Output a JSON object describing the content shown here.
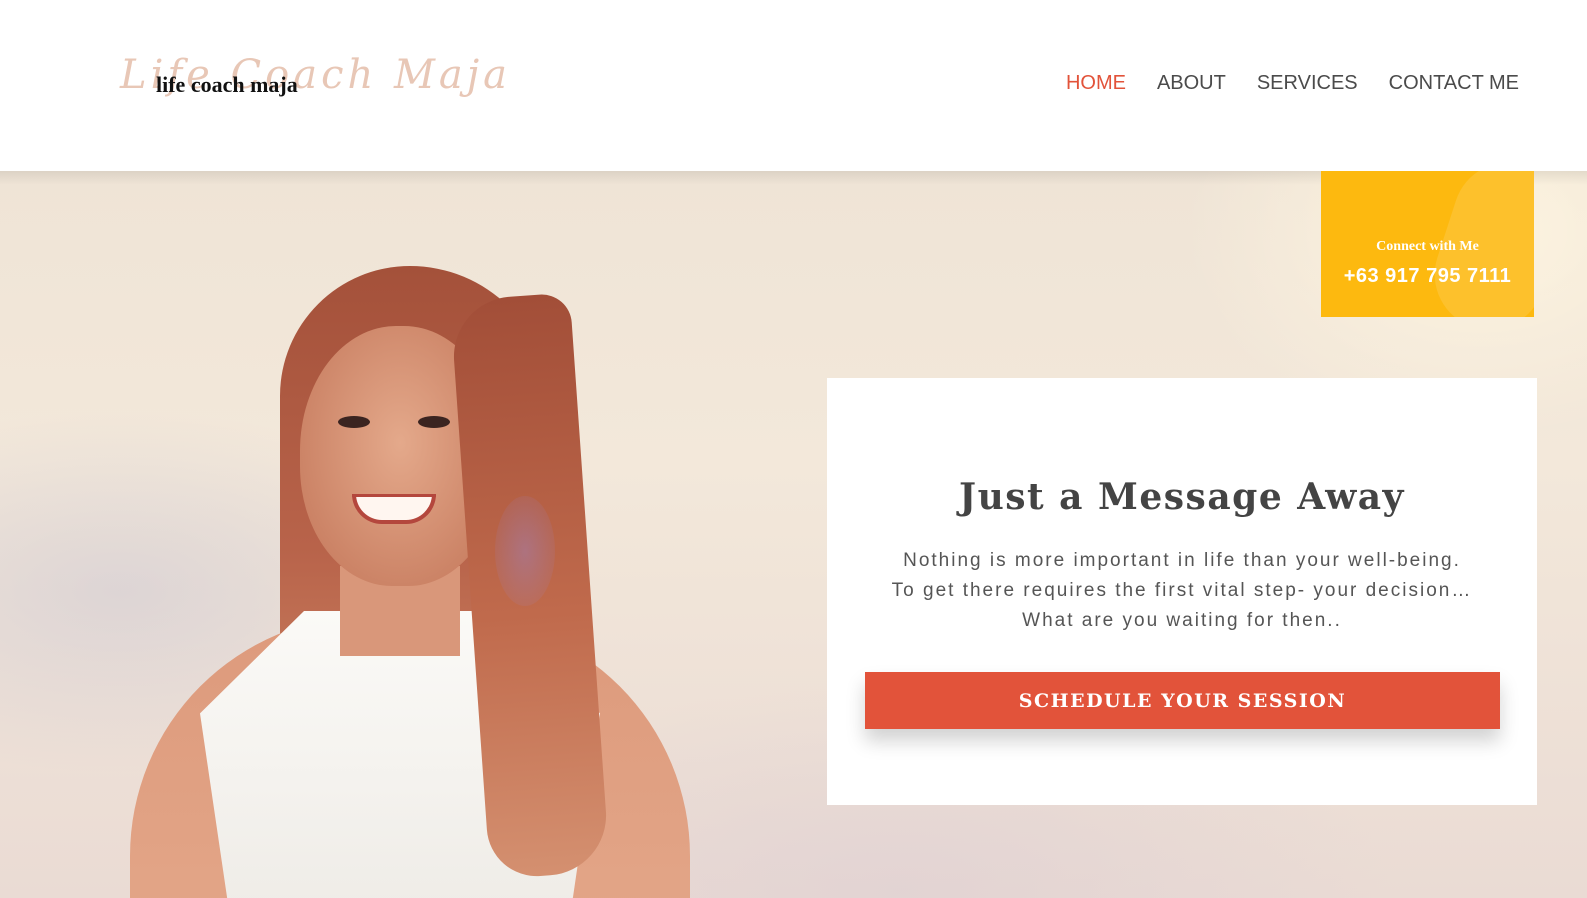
{
  "logo": {
    "script_text": "Life Coach Maja",
    "text": "life coach maja"
  },
  "nav": {
    "items": [
      {
        "label": "HOME",
        "active": true
      },
      {
        "label": "ABOUT",
        "active": false
      },
      {
        "label": "SERVICES",
        "active": false
      },
      {
        "label": "CONTACT ME",
        "active": false
      }
    ]
  },
  "connect": {
    "title": "Connect with Me",
    "phone": "+63 917 795 7111"
  },
  "card": {
    "title": "Just a Message Away",
    "lines": [
      "Nothing is more important in life than your well-being.",
      "To get there requires the first vital step- your decision…",
      "What are you waiting for then.."
    ],
    "cta_label": "SCHEDULE YOUR SESSION"
  },
  "colors": {
    "accent": "#e2533a",
    "badge": "#fdb90f",
    "nav_text": "#4b4b4b"
  }
}
